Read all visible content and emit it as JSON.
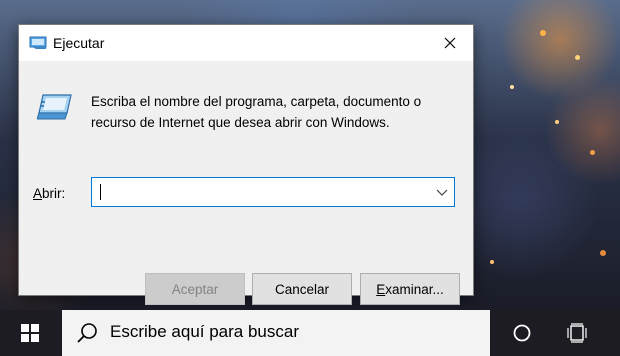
{
  "dialog": {
    "title": "Ejecutar",
    "description": "Escriba el nombre del programa, carpeta, documento o recurso de Internet que desea abrir con Windows.",
    "open_label_accel": "A",
    "open_label_rest": "brir:",
    "open_value": "",
    "buttons": {
      "ok": "Aceptar",
      "cancel": "Cancelar",
      "browse_accel": "E",
      "browse_rest": "xaminar..."
    }
  },
  "taskbar": {
    "search_placeholder": "Escribe aquí para buscar"
  },
  "colors": {
    "accent": "#0078d7",
    "taskbar": "#1c1c22",
    "dialog_bg": "#f0f0f0"
  }
}
